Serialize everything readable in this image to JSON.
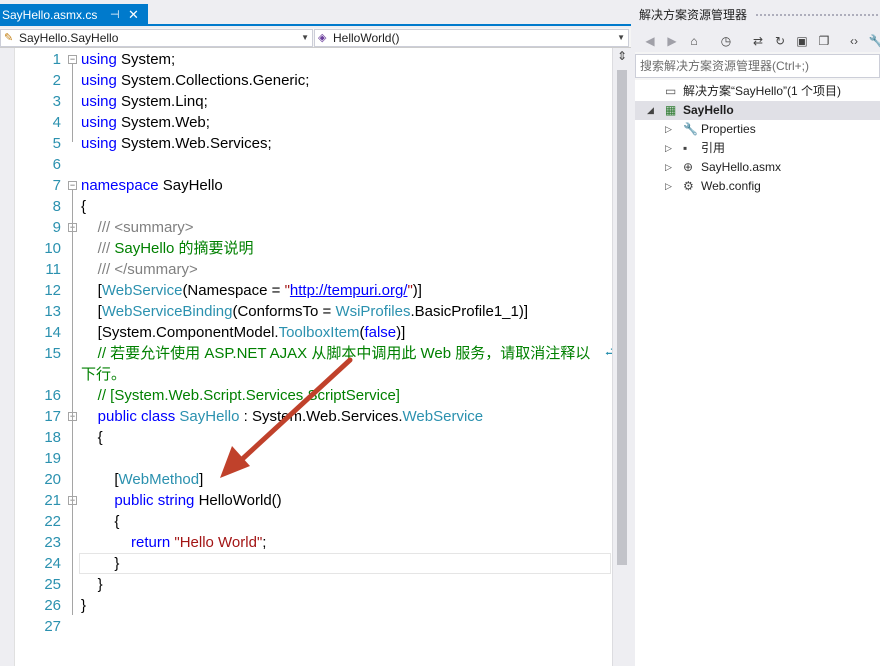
{
  "editor": {
    "tab": {
      "title": "SayHello.asmx.cs",
      "pin_glyph": "⊣",
      "close_glyph": "✕"
    },
    "nav": {
      "class_value": "SayHello.SayHello",
      "member_value": "HelloWorld()"
    }
  },
  "code": {
    "lines": [
      {
        "n": "1",
        "html": "<span class=\"kw\">using</span> System;"
      },
      {
        "n": "2",
        "html": "<span class=\"kw\">using</span> System.Collections.Generic;"
      },
      {
        "n": "3",
        "html": "<span class=\"kw\">using</span> System.Linq;"
      },
      {
        "n": "4",
        "html": "<span class=\"kw\">using</span> System.Web;"
      },
      {
        "n": "5",
        "html": "<span class=\"kw\">using</span> System.Web.Services;"
      },
      {
        "n": "6",
        "html": ""
      },
      {
        "n": "7",
        "html": "<span class=\"kw\">namespace</span> SayHello"
      },
      {
        "n": "8",
        "html": "{"
      },
      {
        "n": "9",
        "html": "    <span class=\"cmg\">///</span> <span class=\"cmg\">&lt;summary&gt;</span>"
      },
      {
        "n": "10",
        "html": "    <span class=\"cmg\">///</span> <span class=\"cm\">SayHello 的摘要说明</span>"
      },
      {
        "n": "11",
        "html": "    <span class=\"cmg\">///</span> <span class=\"cmg\">&lt;/summary&gt;</span>"
      },
      {
        "n": "12",
        "html": "    [<span class=\"ty\">WebService</span>(Namespace = <span class=\"st\">\"</span><span class=\"url\">http://tempuri.org/</span><span class=\"st\">\"</span>)]"
      },
      {
        "n": "13",
        "html": "    [<span class=\"ty\">WebServiceBinding</span>(ConformsTo = <span class=\"ty\">WsiProfiles</span>.BasicProfile1_1)]"
      },
      {
        "n": "14",
        "html": "    [System.ComponentModel.<span class=\"ty\">ToolboxItem</span>(<span class=\"kw\">false</span>)]"
      },
      {
        "n": "15",
        "html": "    <span class=\"cm\">// 若要允许使用 ASP.NET AJAX 从脚本中调用此 Web 服务，请取消注释以</span>"
      },
      {
        "n": "",
        "html": "<span class=\"cm\">下行。</span>"
      },
      {
        "n": "16",
        "html": "    <span class=\"cm\">// [System.Web.Script.Services.ScriptService]</span>"
      },
      {
        "n": "17",
        "html": "    <span class=\"kw\">public</span> <span class=\"kw\">class</span> <span class=\"ty\">SayHello</span> : System.Web.Services.<span class=\"ty\">WebService</span>"
      },
      {
        "n": "18",
        "html": "    {"
      },
      {
        "n": "19",
        "html": ""
      },
      {
        "n": "20",
        "html": "        [<span class=\"ty\">WebMethod</span>]"
      },
      {
        "n": "21",
        "html": "        <span class=\"kw\">public</span> <span class=\"kw\">string</span> HelloWorld()"
      },
      {
        "n": "22",
        "html": "        {"
      },
      {
        "n": "23",
        "html": "            <span class=\"kw\">return</span> <span class=\"st\">\"Hello World\"</span>;"
      },
      {
        "n": "24",
        "html": "        }"
      },
      {
        "n": "25",
        "html": "    }"
      },
      {
        "n": "26",
        "html": "}"
      },
      {
        "n": "27",
        "html": ""
      }
    ],
    "wrap_glyph": "⮐"
  },
  "solution_explorer": {
    "title": "解决方案资源管理器",
    "search_placeholder": "搜索解决方案资源管理器(Ctrl+;)",
    "toolbar": [
      {
        "name": "back-icon",
        "glyph": "◀",
        "dim": true
      },
      {
        "name": "forward-icon",
        "glyph": "▶",
        "dim": true
      },
      {
        "name": "home-icon",
        "glyph": "⌂",
        "dim": false
      },
      {
        "name": "pending-changes-icon",
        "glyph": "◷",
        "dim": false
      },
      {
        "name": "sync-icon",
        "glyph": "⇄",
        "dim": false
      },
      {
        "name": "refresh-icon",
        "glyph": "↻",
        "dim": false
      },
      {
        "name": "collapse-all-icon",
        "glyph": "▣",
        "dim": false
      },
      {
        "name": "show-all-files-icon",
        "glyph": "❐",
        "dim": false
      },
      {
        "name": "view-code-icon",
        "glyph": "‹›",
        "dim": false
      },
      {
        "name": "properties-icon",
        "glyph": "🔧",
        "dim": false
      }
    ],
    "tree": [
      {
        "name": "tree-solution",
        "label": "解决方案“SayHello”(1 个项目)",
        "expander": "",
        "icon": "▭",
        "indent": 0,
        "bold": false,
        "selected": false
      },
      {
        "name": "tree-project-sayhello",
        "label": "SayHello",
        "expander": "◢",
        "icon": "▦",
        "indent": 1,
        "bold": true,
        "selected": true
      },
      {
        "name": "tree-properties",
        "label": "Properties",
        "expander": "▷",
        "icon": "🔧",
        "indent": 2,
        "bold": false,
        "selected": false
      },
      {
        "name": "tree-references",
        "label": "引用",
        "expander": "▷",
        "icon": "▪",
        "indent": 2,
        "bold": false,
        "selected": false
      },
      {
        "name": "tree-sayhello-asmx",
        "label": "SayHello.asmx",
        "expander": "▷",
        "icon": "⊕",
        "indent": 2,
        "bold": false,
        "selected": false
      },
      {
        "name": "tree-web-config",
        "label": "Web.config",
        "expander": "▷",
        "icon": "⚙",
        "indent": 2,
        "bold": false,
        "selected": false
      }
    ]
  },
  "colors": {
    "accent": "#007acc",
    "annotation_arrow": "#c0412b",
    "line_number": "#2b91af"
  }
}
